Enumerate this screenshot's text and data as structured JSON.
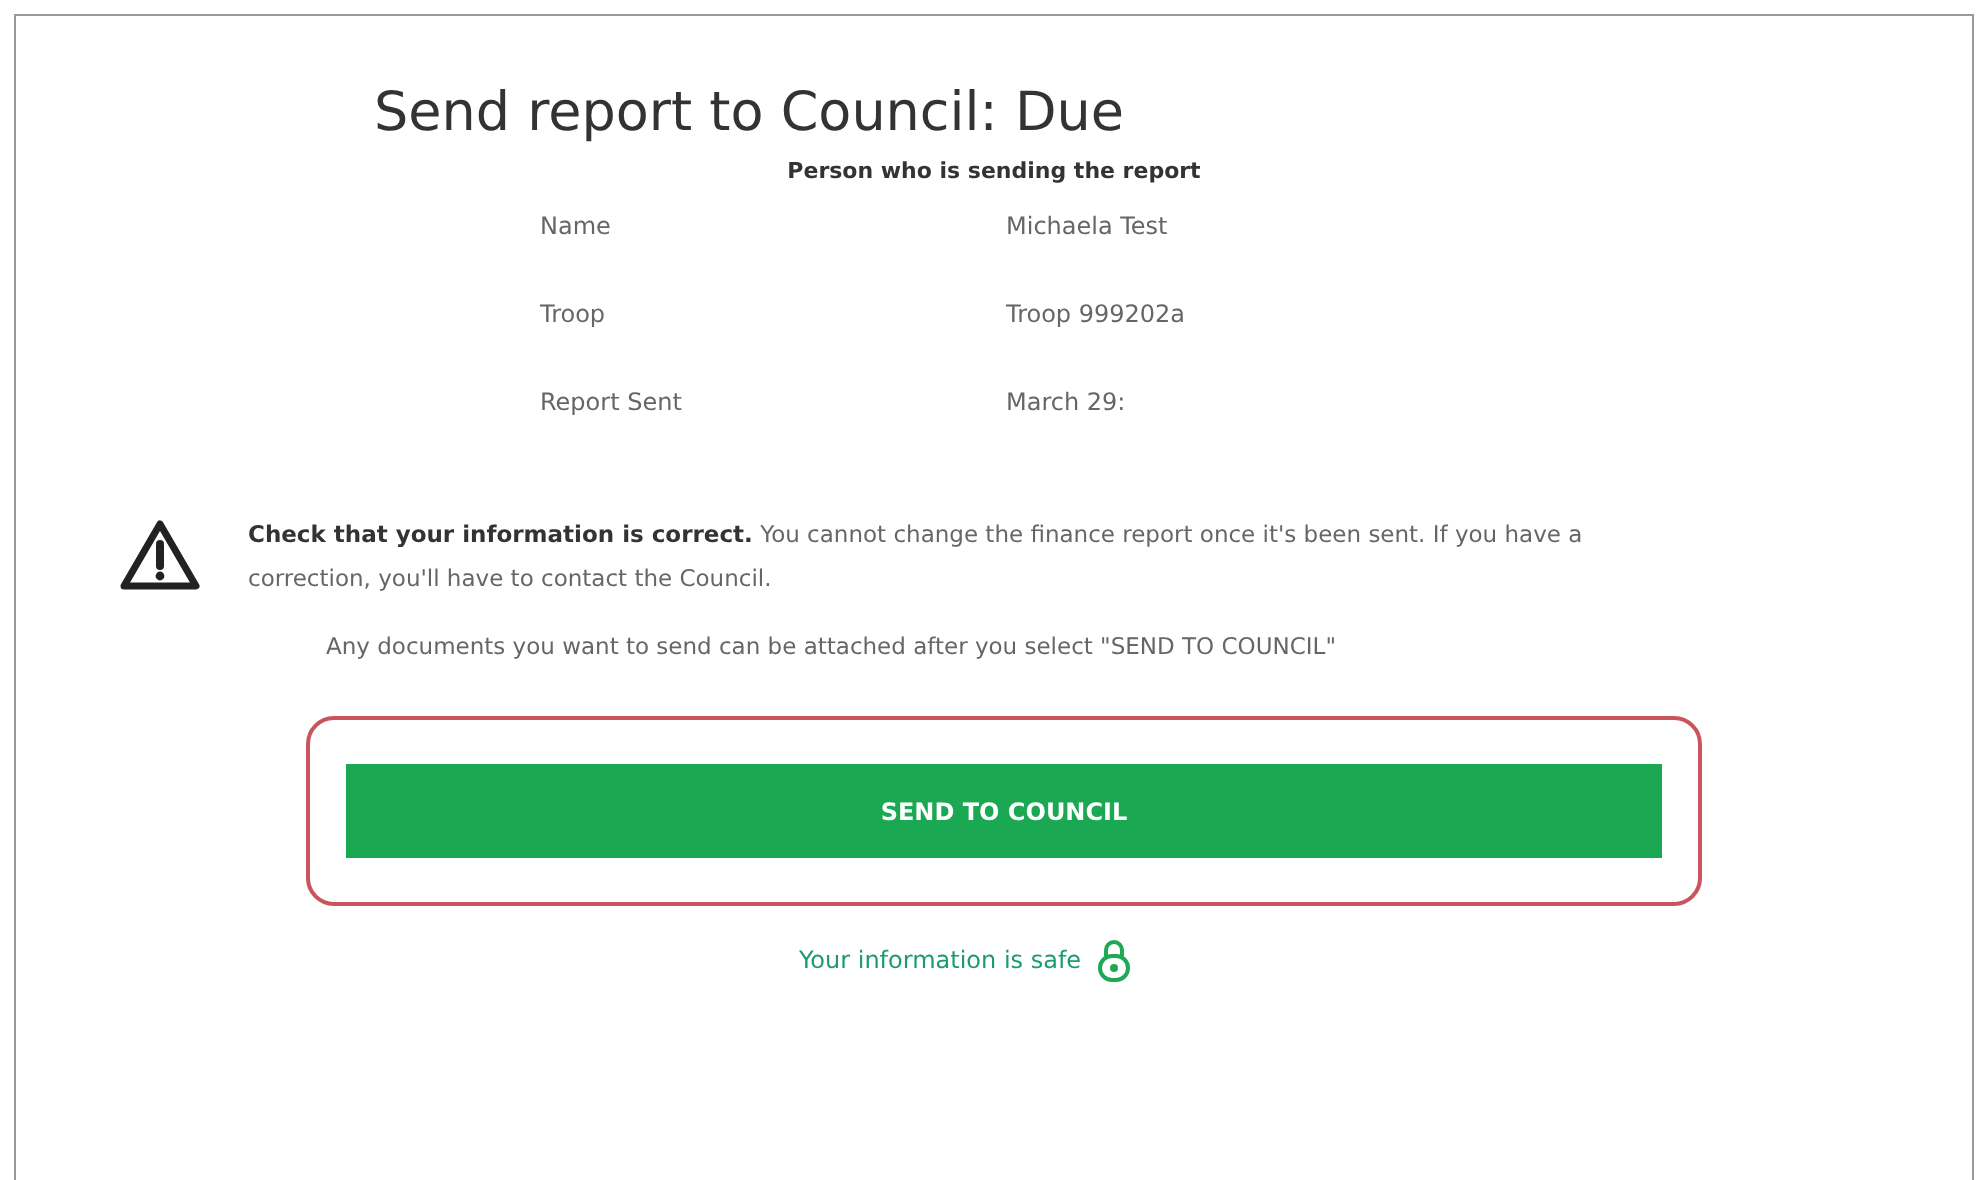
{
  "title": "Send report to Council: Due",
  "subtitle": "Person who is sending the report",
  "details": [
    {
      "label": "Name",
      "value": "Michaela Test"
    },
    {
      "label": "Troop",
      "value": "Troop 999202a"
    },
    {
      "label": "Report Sent",
      "value": "March 29:"
    }
  ],
  "warning": "**Check that your information is correct.** You cannot change the finance report once it's been sent. If you have a correction, you'll have to contact the Council.",
  "note": "Any documents you want to send can be attached after you select \"SEND TO COUNCIL\"",
  "button": "SEND TO COUNCIL",
  "safe_text": "Your information is safe"
}
